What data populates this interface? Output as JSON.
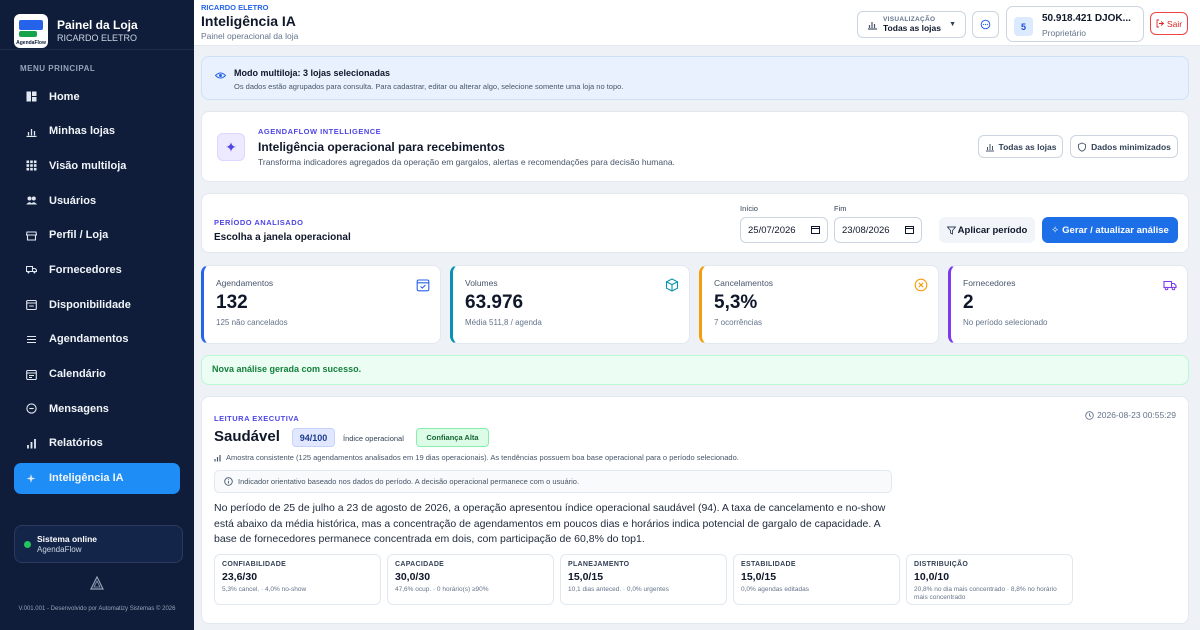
{
  "sidebar": {
    "brand_title": "Painel da Loja",
    "brand_store": "RICARDO ELETRO",
    "brand_logo_text": "AgendaFlow",
    "menu_title": "MENU PRINCIPAL",
    "items": [
      {
        "label": "Home",
        "icon": "grid-icon"
      },
      {
        "label": "Minhas lojas",
        "icon": "chart-icon"
      },
      {
        "label": "Visão multiloja",
        "icon": "apps-icon"
      },
      {
        "label": "Usuários",
        "icon": "users-icon"
      },
      {
        "label": "Perfil / Loja",
        "icon": "store-icon"
      },
      {
        "label": "Fornecedores",
        "icon": "truck-icon"
      },
      {
        "label": "Disponibilidade",
        "icon": "calendar-check-icon"
      },
      {
        "label": "Agendamentos",
        "icon": "list-icon"
      },
      {
        "label": "Calendário",
        "icon": "calendar-icon"
      },
      {
        "label": "Mensagens",
        "icon": "message-icon"
      },
      {
        "label": "Relatórios",
        "icon": "bar-chart-icon"
      },
      {
        "label": "Inteligência IA",
        "icon": "sparkle-icon",
        "active": true
      }
    ],
    "status_title": "Sistema online",
    "status_sub": "AgendaFlow",
    "footer_text": "V.001.001 - Desenvolvido por Automatizy Sistemas © 2026"
  },
  "header": {
    "store": "RICARDO ELETRO",
    "title": "Inteligência IA",
    "subtitle": "Painel operacional da loja",
    "viz_label": "VISUALIZAÇÃO",
    "viz_value": "Todas as lojas",
    "user_badge": "5",
    "user_name": "50.918.421 DJOK...",
    "user_role": "Proprietário",
    "logout": "Sair"
  },
  "multi": {
    "title": "Modo multiloja: 3 lojas selecionadas",
    "text": "Os dados estão agrupados para consulta. Para cadastrar, editar ou alterar algo, selecione somente uma loja no topo."
  },
  "intel": {
    "eyebrow": "AGENDAFLOW INTELLIGENCE",
    "title": "Inteligência operacional para recebimentos",
    "subtitle": "Transforma indicadores agregados da operação em gargalos, alertas e recomendações para decisão humana.",
    "btn_all": "Todas as lojas",
    "btn_min": "Dados minimizados"
  },
  "period": {
    "eyebrow": "PERÍODO ANALISADO",
    "title": "Escolha a janela operacional",
    "start_label": "Início",
    "start_value": "25/07/2026",
    "end_label": "Fim",
    "end_value": "23/08/2026",
    "apply": "Aplicar período",
    "generate": "Gerar / atualizar análise"
  },
  "kpis": [
    {
      "label": "Agendamentos",
      "value": "132",
      "sub": "125 não cancelados",
      "color": "#2563eb",
      "icon": "calendar-icon"
    },
    {
      "label": "Volumes",
      "value": "63.976",
      "sub": "Média 511,8 / agenda",
      "color": "#0891b2",
      "icon": "box-icon"
    },
    {
      "label": "Cancelamentos",
      "value": "5,3%",
      "sub": "7 ocorrências",
      "color": "#f59e0b",
      "icon": "x-circle-icon"
    },
    {
      "label": "Fornecedores",
      "value": "2",
      "sub": "No período selecionado",
      "color": "#7c3aed",
      "icon": "truck-icon"
    }
  ],
  "success": "Nova análise gerada com sucesso.",
  "exec": {
    "eyebrow": "LEITURA EXECUTIVA",
    "timestamp": "2026-08-23 00:55:29",
    "status": "Saudável",
    "score": "94/100",
    "index_label": "Índice operacional",
    "confidence": "Confiança Alta",
    "sample": "Amostra consistente (125 agendamentos analisados em 19 dias operacionais). As tendências possuem boa base operacional para o período selecionado.",
    "note": "Indicador orientativo baseado nos dados do período. A decisão operacional permanece com o usuário.",
    "text": "No período de 25 de julho a 23 de agosto de 2026, a operação apresentou índice operacional saudável (94). A taxa de cancelamento e no-show está abaixo da média histórica, mas a concentração de agendamentos em poucos dias e horários indica potencial de gargalo de capacidade. A base de fornecedores permanece concentrada em dois, com participação de 60,8% do top1.",
    "metrics": [
      {
        "label": "CONFIABILIDADE",
        "value": "23,6/30",
        "sub": "5,3% cancel. · 4,0% no-show"
      },
      {
        "label": "CAPACIDADE",
        "value": "30,0/30",
        "sub": "47,6% ocup. · 0 horário(s) ≥90%"
      },
      {
        "label": "PLANEJAMENTO",
        "value": "15,0/15",
        "sub": "10,1 dias anteced. · 0,0% urgentes"
      },
      {
        "label": "ESTABILIDADE",
        "value": "15,0/15",
        "sub": "0,0% agendas editadas"
      },
      {
        "label": "DISTRIBUIÇÃO",
        "value": "10,0/10",
        "sub": "20,8% no dia mais concentrado · 8,8% no horário mais concentrado"
      }
    ]
  }
}
